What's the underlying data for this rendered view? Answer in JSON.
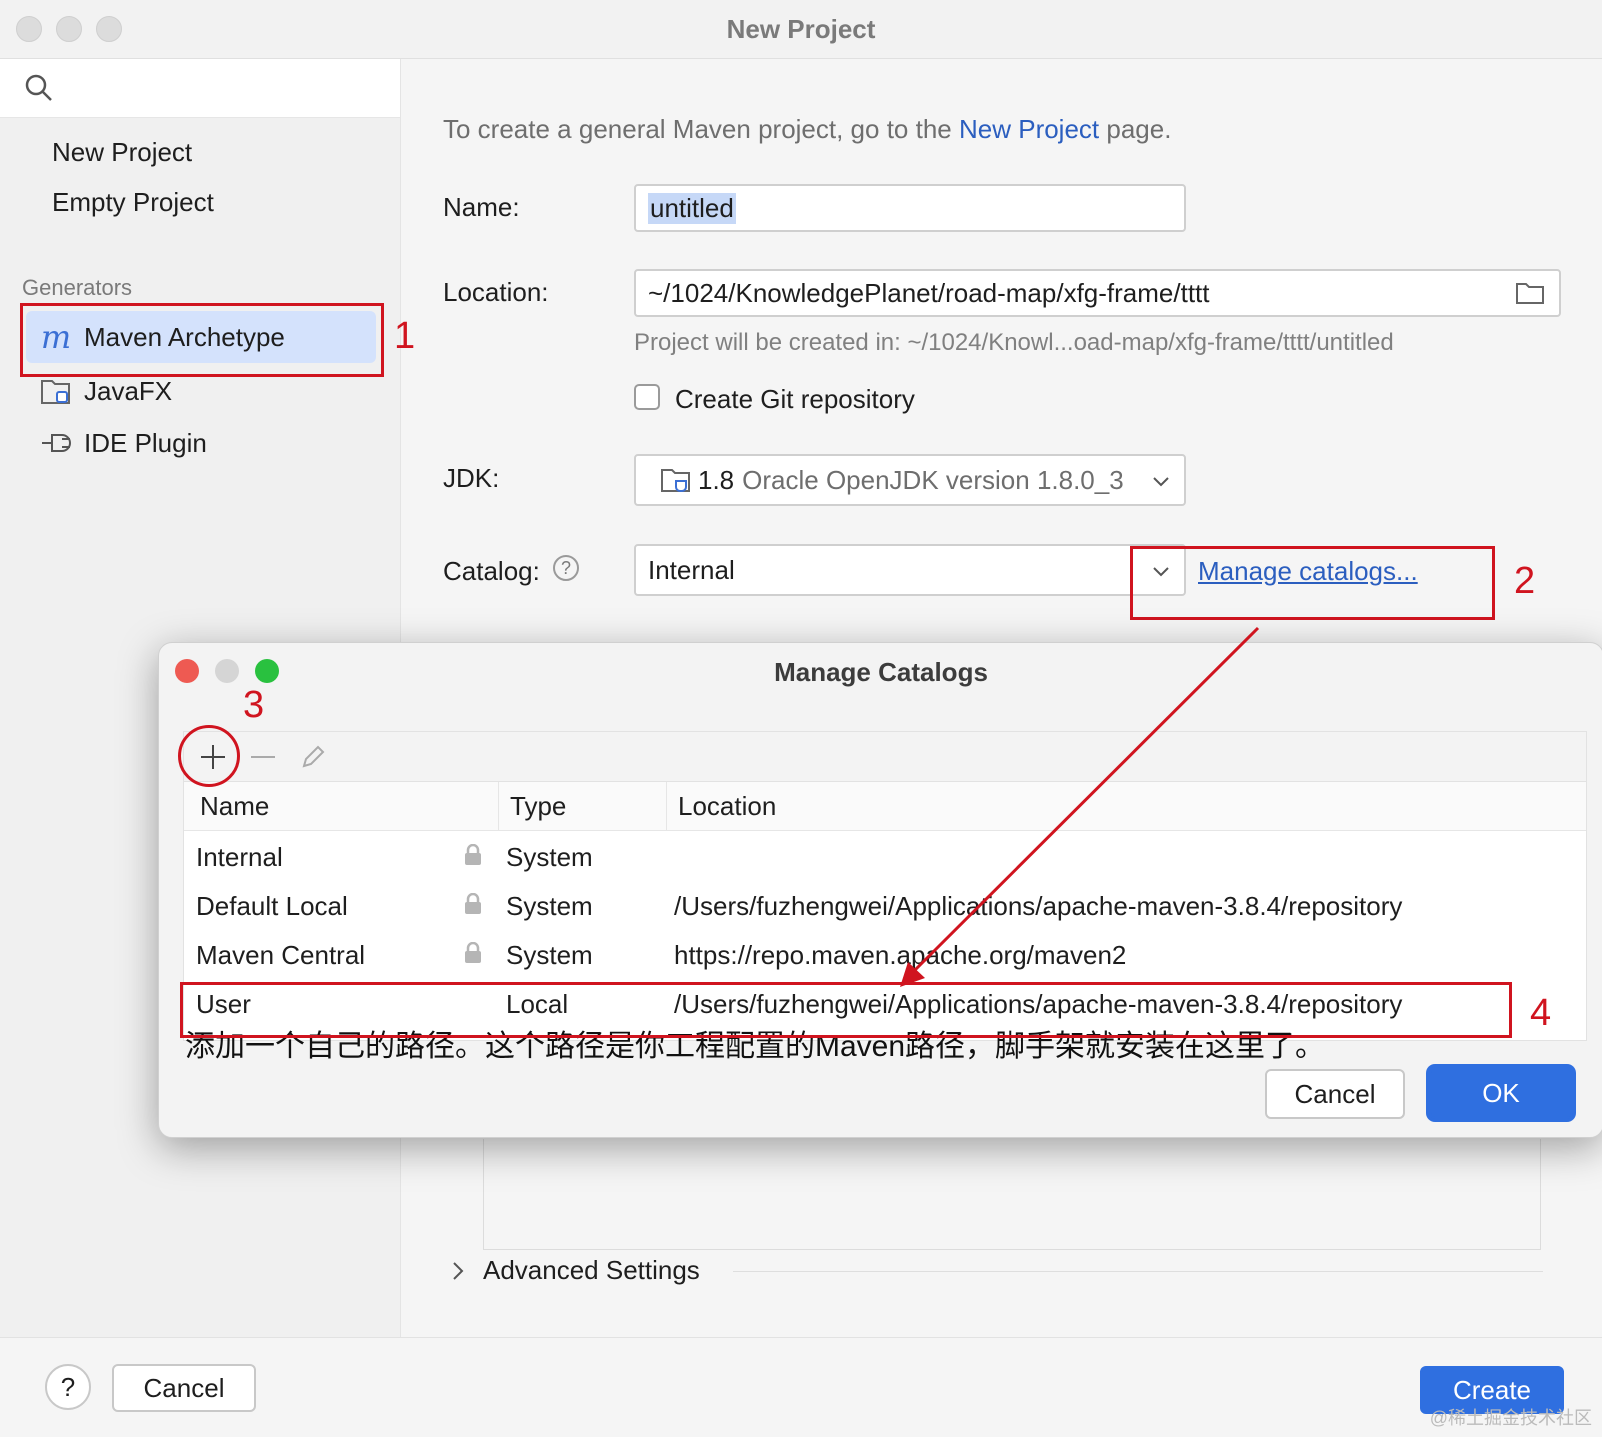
{
  "window": {
    "title": "New Project"
  },
  "sidebar": {
    "items": [
      "New Project",
      "Empty Project"
    ],
    "generators_label": "Generators",
    "generators": [
      {
        "label": "Maven Archetype",
        "icon": "maven-m-icon"
      },
      {
        "label": "JavaFX",
        "icon": "javafx-folder-icon"
      },
      {
        "label": "IDE Plugin",
        "icon": "plugin-plug-icon"
      }
    ]
  },
  "main": {
    "intro_prefix": "To create a general Maven project, go to the ",
    "intro_link": "New Project",
    "intro_suffix": " page.",
    "name_label": "Name:",
    "name_value": "untitled",
    "location_label": "Location:",
    "location_value": "~/1024/KnowledgePlanet/road-map/xfg-frame/tttt",
    "location_hint": "Project will be created in: ~/1024/Knowl...oad-map/xfg-frame/tttt/untitled",
    "git_label": "Create Git repository",
    "jdk_label": "JDK:",
    "jdk_version": "1.8",
    "jdk_desc": "Oracle OpenJDK version 1.8.0_3",
    "catalog_label": "Catalog:",
    "catalog_value": "Internal",
    "manage_link": "Manage catalogs...",
    "advanced": "Advanced Settings"
  },
  "dialog": {
    "title": "Manage Catalogs",
    "columns": [
      "Name",
      "Type",
      "Location"
    ],
    "rows": [
      {
        "name": "Internal",
        "type": "System",
        "location": "",
        "locked": true
      },
      {
        "name": "Default Local",
        "type": "System",
        "location": "/Users/fuzhengwei/Applications/apache-maven-3.8.4/repository",
        "locked": true
      },
      {
        "name": "Maven Central",
        "type": "System",
        "location": "https://repo.maven.apache.org/maven2",
        "locked": true
      },
      {
        "name": "User",
        "type": "Local",
        "location": "/Users/fuzhengwei/Applications/apache-maven-3.8.4/repository",
        "locked": false
      }
    ],
    "cancel": "Cancel",
    "ok": "OK"
  },
  "annotations": {
    "n1": "1",
    "n2": "2",
    "n3": "3",
    "n4": "4",
    "note": "添加一个自己的路径。这个路径是你工程配置的Maven路径，脚手架就安装在这里了。"
  },
  "footer": {
    "help": "?",
    "cancel": "Cancel",
    "create": "Create"
  },
  "watermark": "@稀土掘金技术社区",
  "colors": {
    "accent": "#2f6fe0",
    "selection": "#d4e2fc",
    "annotation": "#d0141f",
    "link": "#2b5ebf"
  }
}
